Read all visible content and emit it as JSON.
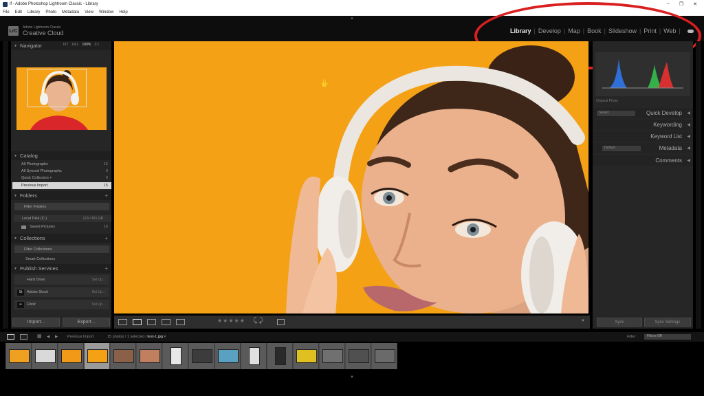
{
  "window": {
    "title": "lf - Adobe Photoshop Lightroom Classic - Library",
    "controls": [
      "–",
      "❐",
      "✕"
    ]
  },
  "menu": [
    "File",
    "Edit",
    "Library",
    "Photo",
    "Metadata",
    "View",
    "Window",
    "Help"
  ],
  "identity": {
    "logo": "LrC",
    "top": "Adobe Lightroom Classic",
    "main": "Creative Cloud"
  },
  "modules": [
    "Library",
    "Develop",
    "Map",
    "Book",
    "Slideshow",
    "Print",
    "Web"
  ],
  "active_module": "Library",
  "left_panel": {
    "navigator": {
      "title": "Navigator",
      "zoom": [
        "FIT",
        "FILL",
        "100%",
        "3:1"
      ]
    },
    "catalog": {
      "title": "Catalog",
      "items": [
        {
          "label": "All Photographs",
          "count": "15"
        },
        {
          "label": "All Synced Photographs",
          "count": "0"
        },
        {
          "label": "Quick Collection +",
          "count": "0"
        },
        {
          "label": "Previous Import",
          "count": "15"
        }
      ]
    },
    "folders": {
      "title": "Folders",
      "filter": "Filter Folders",
      "disk": {
        "label": "Local Disk (C:)",
        "value": "123 / 451 GB"
      },
      "subfolder": {
        "label": "Saved Pictures",
        "count": "15"
      }
    },
    "collections": {
      "title": "Collections",
      "filter": "Filter Collections",
      "smart": "Smart Collections"
    },
    "publish": {
      "title": "Publish Services",
      "services": [
        {
          "label": "Hard Drive",
          "setup": "Set Up..."
        },
        {
          "label": "Adobe Stock",
          "setup": "Set Up...",
          "badge": "St"
        },
        {
          "label": "Flickr",
          "setup": "Set Up...",
          "badge": "••"
        }
      ]
    },
    "import_label": "Import...",
    "export_label": "Export..."
  },
  "right_panel": {
    "histogram_label": "Original Photo",
    "saved_preset": "Saved",
    "panels": [
      "Quick Develop",
      "Keywording",
      "Keyword List",
      "Metadata",
      "Comments"
    ],
    "metadata_preset": "Default",
    "sync_label": "Sync",
    "sync_settings_label": "Sync Settings"
  },
  "toolbar": {
    "stars": "★★★★★"
  },
  "filmstrip": {
    "source_label": "Previous Import",
    "info": "15 photos / 1 selected / ",
    "filename": "test-1.jpg",
    "filter_label": "Filter :",
    "filter_value": "Filters Off",
    "thumb_colors": [
      "#f0a020",
      "#d9d9d9",
      "#f29a18",
      "#f4a116",
      "#8a6048",
      "#c08060",
      "#e8e8e8",
      "#3c3c3c",
      "#5aa0c0",
      "#e0e0e0",
      "#2a2a2a",
      "#e0c020",
      "#707070",
      "#505050",
      "#6a6a6a"
    ],
    "selected_index": 3
  },
  "colors": {
    "accent_circle": "#d92020",
    "photo_bg": "#f4a116",
    "panel_bg": "#262626"
  }
}
